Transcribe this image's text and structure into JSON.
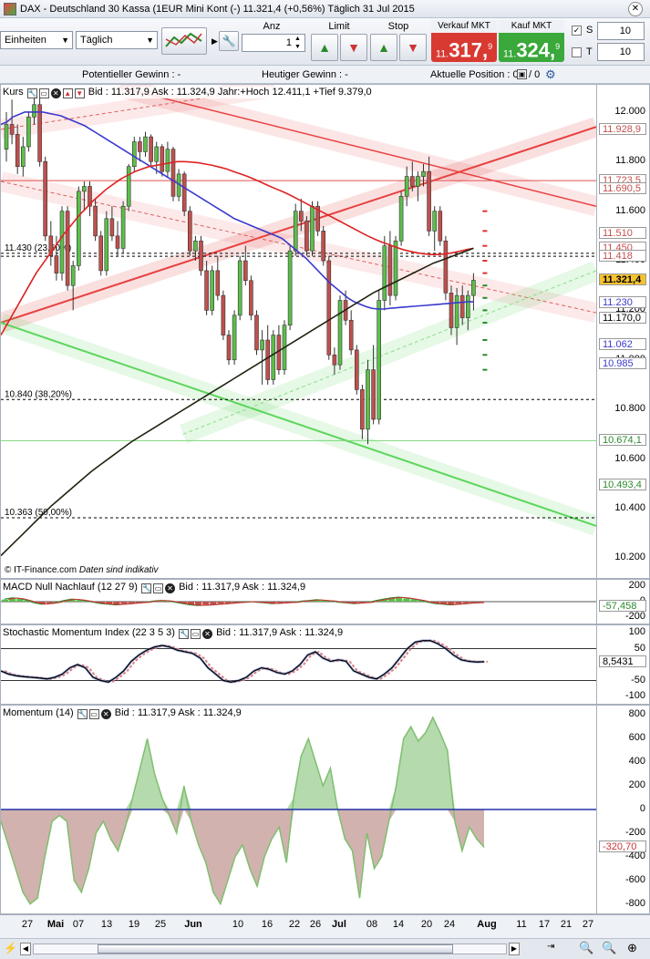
{
  "window": {
    "title": "DAX - Deutschland 30 Kassa (1EUR Mini Kont (-)    11.321,4 (+0,56%)    Täglich  31 Jul 2015"
  },
  "toolbar": {
    "unit_select": "Einheiten",
    "period_select": "Täglich",
    "qty_label": "Anz",
    "qty_value": "1",
    "limit_label": "Limit",
    "stop_label": "Stop",
    "sell_label": "Verkauf MKT",
    "sell_big": "317",
    "sell_small": "11.",
    "sell_frac": "9",
    "buy_label": "Kauf MKT",
    "buy_big": "324",
    "buy_small": "11.",
    "buy_frac": "9",
    "s_label": "S",
    "t_label": "T",
    "s_value": "10",
    "t_value": "10"
  },
  "infobar": {
    "pot_gain": "Potentieller Gewinn : -",
    "today_gain": "Heutiger Gewinn : -",
    "position": "Aktuelle Position : 0",
    "position_after": "/ 0"
  },
  "colors": {
    "up": "#5cbf4a",
    "down": "#c0504d",
    "sma_blue": "#3a3acc",
    "sma_red": "#dd2222",
    "sma_dark": "#222211",
    "sell_bg": "#d83a32",
    "buy_bg": "#3aa83a"
  },
  "chart_data": [
    {
      "type": "candlestick",
      "panel": "Kurs",
      "header": "Bid : 11.317,9 Ask : 11.324,9 Jahr:+Hoch 12.411,1 +Tief 9.379,0",
      "ylim": [
        10120,
        12110
      ],
      "yticks": [
        10200,
        10400,
        10600,
        10800,
        11000,
        11200,
        11400,
        11600,
        11800,
        12000
      ],
      "ytick_labels": [
        "10.200",
        "10.400",
        "10.600",
        "10.800",
        "11.000",
        "11.200",
        "11.400",
        "11.600",
        "11.800",
        "12.000"
      ],
      "price_tags": [
        {
          "value": 11928.9,
          "label": "11.928,9",
          "color": "#c0504d"
        },
        {
          "value": 11723.5,
          "label": "11.723,5",
          "color": "#c0504d"
        },
        {
          "value": 11690.5,
          "label": "11.690,5",
          "color": "#c0504d"
        },
        {
          "value": 11510,
          "label": "11.510",
          "color": "#c0504d"
        },
        {
          "value": 11450,
          "label": "11.450",
          "color": "#c0504d"
        },
        {
          "value": 11418,
          "label": "11.418",
          "color": "#c0504d"
        },
        {
          "value": 11321.4,
          "label": "11.321,4",
          "color": "#000000",
          "highlight": true
        },
        {
          "value": 11230,
          "label": "11.230",
          "color": "#3a3acc"
        },
        {
          "value": 11170,
          "label": "11.170,0",
          "color": "#000000"
        },
        {
          "value": 11062,
          "label": "11.062",
          "color": "#3a3acc"
        },
        {
          "value": 10985,
          "label": "10.985",
          "color": "#3a3acc"
        },
        {
          "value": 10674.1,
          "label": "10.674,1",
          "color": "#2c8a2c"
        },
        {
          "value": 10493.4,
          "label": "10.493,4",
          "color": "#2c8a2c"
        }
      ],
      "fib_levels": [
        {
          "value": 11430,
          "label": "11.430 (23,60%)"
        },
        {
          "value": 10840,
          "label": "10.840 (38,20%)"
        },
        {
          "value": 10363,
          "label": "10.363 (50,00%)"
        }
      ],
      "horizontal_lines": [
        {
          "value": 11723.5,
          "color": "#e05050"
        },
        {
          "value": 10674.1,
          "color": "#7ad87a"
        },
        {
          "value": 11418,
          "color": "#000000",
          "dashed": true
        }
      ],
      "candles": [
        [
          11850,
          12000,
          11800,
          11950
        ],
        [
          11950,
          12050,
          11870,
          11910
        ],
        [
          11910,
          11950,
          11750,
          11780
        ],
        [
          11780,
          11900,
          11740,
          11860
        ],
        [
          11860,
          12000,
          11840,
          11980
        ],
        [
          11980,
          12060,
          11950,
          12030
        ],
        [
          12030,
          12070,
          11780,
          11800
        ],
        [
          11800,
          11820,
          11480,
          11500
        ],
        [
          11500,
          11560,
          11380,
          11420
        ],
        [
          11420,
          11500,
          11320,
          11350
        ],
        [
          11350,
          11620,
          11320,
          11600
        ],
        [
          11600,
          11620,
          11280,
          11300
        ],
        [
          11300,
          11400,
          11200,
          11380
        ],
        [
          11380,
          11700,
          11360,
          11680
        ],
        [
          11680,
          11720,
          11600,
          11700
        ],
        [
          11700,
          11720,
          11580,
          11620
        ],
        [
          11620,
          11650,
          11480,
          11500
        ],
        [
          11500,
          11520,
          11340,
          11360
        ],
        [
          11360,
          11600,
          11340,
          11570
        ],
        [
          11570,
          11620,
          11480,
          11500
        ],
        [
          11500,
          11560,
          11420,
          11450
        ],
        [
          11450,
          11640,
          11430,
          11620
        ],
        [
          11620,
          11790,
          11600,
          11780
        ],
        [
          11780,
          11900,
          11760,
          11880
        ],
        [
          11880,
          11900,
          11800,
          11840
        ],
        [
          11840,
          11920,
          11820,
          11900
        ],
        [
          11900,
          11910,
          11780,
          11800
        ],
        [
          11800,
          11880,
          11750,
          11860
        ],
        [
          11860,
          11870,
          11740,
          11760
        ],
        [
          11760,
          11880,
          11740,
          11850
        ],
        [
          11850,
          11860,
          11640,
          11660
        ],
        [
          11660,
          11770,
          11640,
          11750
        ],
        [
          11750,
          11760,
          11580,
          11600
        ],
        [
          11600,
          11620,
          11420,
          11440
        ],
        [
          11440,
          11500,
          11400,
          11480
        ],
        [
          11480,
          11500,
          11340,
          11360
        ],
        [
          11360,
          11400,
          11180,
          11200
        ],
        [
          11200,
          11380,
          11180,
          11360
        ],
        [
          11360,
          11420,
          11240,
          11260
        ],
        [
          11260,
          11280,
          11080,
          11100
        ],
        [
          11100,
          11120,
          10980,
          11000
        ],
        [
          11000,
          11200,
          10980,
          11180
        ],
        [
          11180,
          11420,
          11160,
          11400
        ],
        [
          11400,
          11460,
          11300,
          11320
        ],
        [
          11320,
          11340,
          11160,
          11180
        ],
        [
          11180,
          11200,
          11020,
          11040
        ],
        [
          11040,
          11120,
          10900,
          11080
        ],
        [
          11080,
          11140,
          10900,
          10920
        ],
        [
          10920,
          11120,
          10900,
          11100
        ],
        [
          11100,
          11140,
          10940,
          10960
        ],
        [
          10960,
          11160,
          10940,
          11140
        ],
        [
          11140,
          11460,
          11120,
          11440
        ],
        [
          11440,
          11630,
          11420,
          11600
        ],
        [
          11600,
          11650,
          11520,
          11560
        ],
        [
          11560,
          11580,
          11420,
          11440
        ],
        [
          11440,
          11640,
          11420,
          11620
        ],
        [
          11620,
          11640,
          11500,
          11520
        ],
        [
          11520,
          11540,
          11380,
          11400
        ],
        [
          11400,
          11420,
          11000,
          11020
        ],
        [
          11020,
          11050,
          10940,
          10980
        ],
        [
          10980,
          11260,
          10960,
          11240
        ],
        [
          11240,
          11280,
          11140,
          11160
        ],
        [
          11160,
          11200,
          11020,
          11040
        ],
        [
          11040,
          11060,
          10860,
          10880
        ],
        [
          10880,
          10900,
          10680,
          10720
        ],
        [
          10720,
          11000,
          10660,
          10960
        ],
        [
          10960,
          11060,
          10740,
          10760
        ],
        [
          10760,
          11280,
          10740,
          11240
        ],
        [
          11240,
          11500,
          11200,
          11460
        ],
        [
          11460,
          11520,
          11220,
          11260
        ],
        [
          11260,
          11500,
          11240,
          11480
        ],
        [
          11480,
          11680,
          11460,
          11660
        ],
        [
          11660,
          11780,
          11620,
          11740
        ],
        [
          11740,
          11800,
          11680,
          11700
        ],
        [
          11700,
          11760,
          11640,
          11740
        ],
        [
          11740,
          11790,
          11700,
          11760
        ],
        [
          11760,
          11820,
          11500,
          11520
        ],
        [
          11520,
          11620,
          11440,
          11600
        ],
        [
          11600,
          11620,
          11460,
          11480
        ],
        [
          11480,
          11500,
          11240,
          11270
        ],
        [
          11270,
          11300,
          11100,
          11130
        ],
        [
          11130,
          11290,
          11060,
          11260
        ],
        [
          11260,
          11300,
          11140,
          11170
        ],
        [
          11170,
          11280,
          11120,
          11260
        ],
        [
          11260,
          11350,
          11200,
          11321
        ]
      ],
      "series": [
        {
          "name": "SMA blue",
          "values": [
            11950,
            11960,
            11980,
            11990,
            12000,
            12000,
            12000,
            12000,
            11995,
            11990,
            11985,
            11975,
            11965,
            11955,
            11945,
            11930,
            11915,
            11900,
            11885,
            11870,
            11855,
            11840,
            11825,
            11810,
            11795,
            11780,
            11765,
            11750,
            11735,
            11720,
            11705,
            11690,
            11675,
            11660,
            11645,
            11630,
            11615,
            11600,
            11585,
            11570,
            11560,
            11550,
            11540,
            11530,
            11520,
            11510,
            11500,
            11490,
            11470,
            11450,
            11430,
            11410,
            11385,
            11360,
            11335,
            11310,
            11290,
            11270,
            11250,
            11235,
            11225,
            11215,
            11208,
            11205,
            11205,
            11208,
            11210,
            11212,
            11214,
            11216,
            11218,
            11220,
            11222,
            11224,
            11226,
            11228,
            11230,
            11232,
            11234,
            11234
          ]
        },
        {
          "name": "SMA red",
          "values": [
            11100,
            11150,
            11200,
            11250,
            11300,
            11350,
            11390,
            11430,
            11470,
            11510,
            11545,
            11580,
            11610,
            11640,
            11665,
            11690,
            11710,
            11730,
            11745,
            11760,
            11770,
            11780,
            11785,
            11790,
            11795,
            11800,
            11800,
            11798,
            11795,
            11790,
            11785,
            11778,
            11770,
            11760,
            11750,
            11740,
            11728,
            11715,
            11702,
            11690,
            11678,
            11665,
            11650,
            11635,
            11620,
            11605,
            11590,
            11575,
            11560,
            11545,
            11530,
            11515,
            11500,
            11487,
            11475,
            11465,
            11455,
            11445,
            11438,
            11432,
            11428,
            11425,
            11425,
            11428,
            11432,
            11438,
            11445,
            11450
          ]
        },
        {
          "name": "SMA dark",
          "values": [
            10210,
            10250,
            10290,
            10330,
            10370,
            10410,
            10445,
            10480,
            10515,
            10550,
            10580,
            10610,
            10640,
            10670,
            10695,
            10720,
            10745,
            10770,
            10795,
            10820,
            10845,
            10870,
            10895,
            10920,
            10945,
            10970,
            10995,
            11020,
            11045,
            11070,
            11095,
            11120,
            11145,
            11170,
            11195,
            11220,
            11245,
            11270,
            11290,
            11310,
            11330,
            11350,
            11370,
            11390,
            11405,
            11420,
            11435,
            11450
          ]
        }
      ]
    },
    {
      "type": "bar",
      "panel": "MACD Null Nachlauf (12 27 9)",
      "header": "Bid : 11.317,9 Ask : 11.324,9",
      "ylim": [
        -200,
        200
      ],
      "yticks": [
        -200,
        0,
        200
      ],
      "ytick_labels": [
        "-200",
        "0",
        "200"
      ],
      "last_value": "-57,458"
    },
    {
      "type": "line",
      "panel": "Stochastic Momentum Index (22 3 5 3)",
      "header": "Bid : 11.317,9 Ask : 11.324,9",
      "ylim": [
        -100,
        100
      ],
      "yticks": [
        -100,
        -50,
        0,
        50,
        100
      ],
      "ytick_labels": [
        "-100",
        "-50",
        "0",
        "50",
        "100"
      ],
      "last_value": "8,5431",
      "values": [
        -20,
        -30,
        -35,
        -38,
        -40,
        -42,
        -45,
        -40,
        -30,
        -10,
        0,
        -10,
        -40,
        -50,
        -55,
        -40,
        -20,
        10,
        30,
        45,
        55,
        60,
        55,
        45,
        40,
        35,
        20,
        -10,
        -30,
        -50,
        -55,
        -50,
        -40,
        -20,
        -10,
        -15,
        -25,
        -30,
        -20,
        0,
        30,
        40,
        20,
        10,
        15,
        10,
        -20,
        -30,
        -40,
        -45,
        -30,
        -10,
        20,
        50,
        70,
        75,
        75,
        65,
        50,
        30,
        15,
        10,
        8,
        9
      ]
    },
    {
      "type": "area",
      "panel": "Momentum (14)",
      "header": "Bid : 11.317,9 Ask : 11.324,9",
      "ylim": [
        -880,
        880
      ],
      "yticks": [
        -800,
        -600,
        -400,
        -200,
        0,
        200,
        400,
        600,
        800
      ],
      "ytick_labels": [
        "-800",
        "-600",
        "-400",
        "-200",
        "0",
        "200",
        "400",
        "600",
        "800"
      ],
      "last_value": "-320,70",
      "values": [
        -100,
        -300,
        -500,
        -700,
        -800,
        -750,
        -400,
        -100,
        -50,
        -100,
        -600,
        -700,
        -500,
        -200,
        -100,
        -250,
        -350,
        -150,
        100,
        350,
        600,
        300,
        100,
        -50,
        -200,
        200,
        -100,
        -300,
        -450,
        -700,
        -800,
        -600,
        -400,
        -300,
        -500,
        -650,
        -400,
        -250,
        -150,
        -450,
        100,
        450,
        600,
        400,
        200,
        350,
        0,
        -250,
        -350,
        -750,
        -200,
        -500,
        -400,
        -100,
        200,
        600,
        700,
        580,
        650,
        780,
        650,
        500,
        -100,
        -350,
        -150,
        -250,
        -320
      ]
    }
  ],
  "xaxis": {
    "labels": [
      "27",
      "Mai",
      "07",
      "13",
      "19",
      "25",
      "Jun",
      "10",
      "16",
      "22",
      "26",
      "Jul",
      "08",
      "14",
      "20",
      "24",
      "Aug",
      "11",
      "17",
      "21",
      "27"
    ]
  },
  "footer": {
    "copyright": "© IT-Finance.com",
    "note": "Daten sind indikativ"
  }
}
